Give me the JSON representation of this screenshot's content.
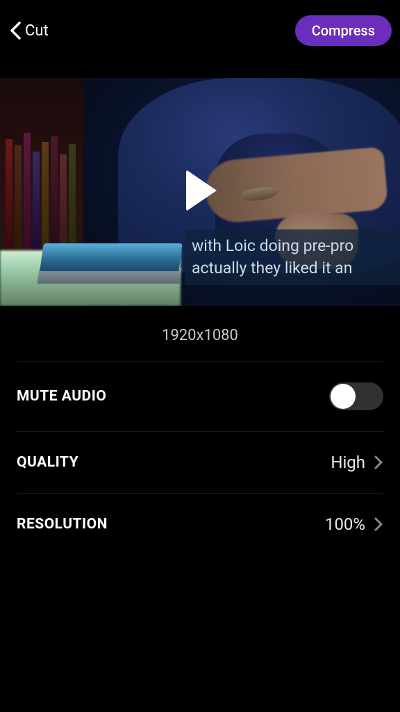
{
  "header": {
    "back_label": "Cut",
    "compress_label": "Compress"
  },
  "preview": {
    "subtitle_line1": "with Loic doing pre-pro",
    "subtitle_line2": "actually they liked it an",
    "dimensions": "1920x1080"
  },
  "settings": {
    "mute_audio": {
      "label": "MUTE AUDIO",
      "value": false
    },
    "quality": {
      "label": "QUALITY",
      "value": "High"
    },
    "resolution": {
      "label": "RESOLUTION",
      "value": "100%"
    }
  }
}
